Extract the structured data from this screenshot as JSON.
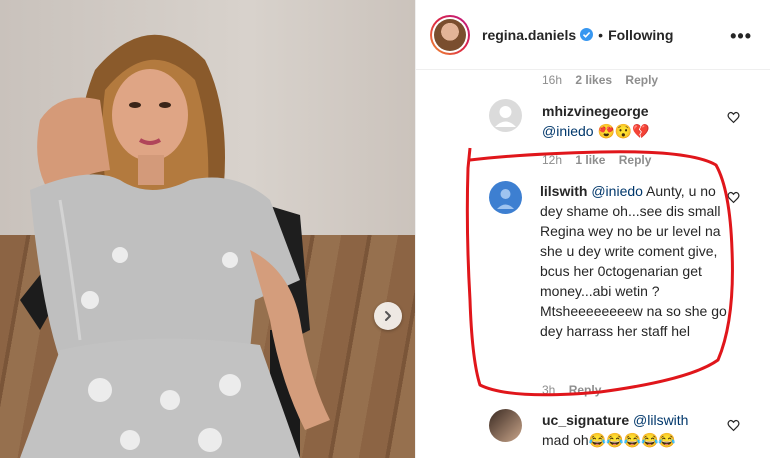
{
  "post": {
    "author": "regina.daniels",
    "follow_state": "Following",
    "separator": "•",
    "more_label": "•••"
  },
  "comments": [
    {
      "time": "16h",
      "likes": "2 likes",
      "reply": "Reply"
    },
    {
      "username": "mhizvinegeorge",
      "mention": "@iniedo",
      "text": "😍😯💔",
      "time": "12h",
      "likes": "1 like",
      "reply": "Reply"
    },
    {
      "username": "lilswith",
      "mention": "@iniedo",
      "text": "Aunty, u no dey shame oh...see dis small Regina wey no be ur level na she u dey write coment give, bcus her 0ctogenarian get money...abi wetin ? Mtsheeeeeeeew na so she go dey harrass her staff hel",
      "time": "3h",
      "reply": "Reply"
    },
    {
      "username": "uc_signature",
      "mention": "@lilswith",
      "text": "mad oh😂😂😂😂😂"
    }
  ],
  "colors": {
    "annotation": "#e0161b",
    "link": "#00376b",
    "verified": "#3897f0"
  }
}
